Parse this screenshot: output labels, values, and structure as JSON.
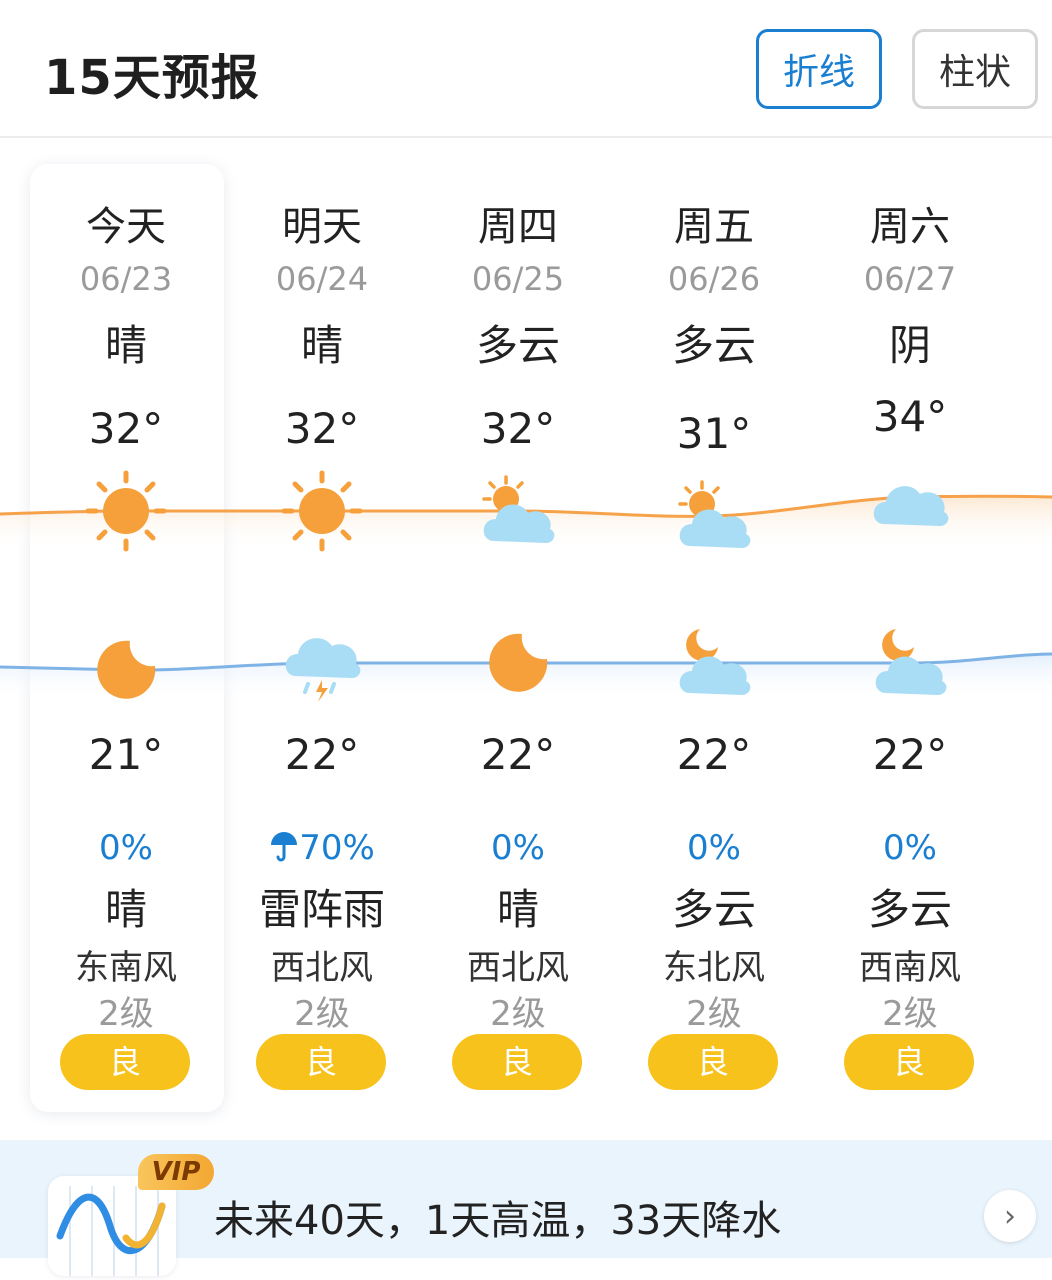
{
  "header": {
    "title": "15天预报",
    "toggle_line_label": "折线",
    "toggle_bar_label": "柱状",
    "active_toggle": "折线"
  },
  "colors": {
    "accent": "#1a7fd1",
    "high_curve": "#f5a24a",
    "low_curve": "#7fb3e6",
    "aqi_good": "#f7c21c"
  },
  "days": [
    {
      "name": "今天",
      "date": "06/23",
      "day_cond": "晴",
      "high": "32°",
      "day_icon": "sun-icon",
      "night_icon": "moon-icon",
      "low": "21°",
      "precip": "0%",
      "precip_icon": "",
      "night_cond": "晴",
      "wind_dir": "东南风",
      "wind_level": "2级",
      "aqi": "良"
    },
    {
      "name": "明天",
      "date": "06/24",
      "day_cond": "晴",
      "high": "32°",
      "day_icon": "sun-icon",
      "night_icon": "thunder-rain-icon",
      "low": "22°",
      "precip": "70%",
      "precip_icon": "umbrella-icon",
      "night_cond": "雷阵雨",
      "wind_dir": "西北风",
      "wind_level": "2级",
      "aqi": "良"
    },
    {
      "name": "周四",
      "date": "06/25",
      "day_cond": "多云",
      "high": "32°",
      "day_icon": "partly-cloudy-day-icon",
      "night_icon": "moon-icon",
      "low": "22°",
      "precip": "0%",
      "precip_icon": "",
      "night_cond": "晴",
      "wind_dir": "西北风",
      "wind_level": "2级",
      "aqi": "良"
    },
    {
      "name": "周五",
      "date": "06/26",
      "day_cond": "多云",
      "high": "31°",
      "day_icon": "partly-cloudy-day-icon",
      "night_icon": "partly-cloudy-night-icon",
      "low": "22°",
      "precip": "0%",
      "precip_icon": "",
      "night_cond": "多云",
      "wind_dir": "东北风",
      "wind_level": "2级",
      "aqi": "良"
    },
    {
      "name": "周六",
      "date": "06/27",
      "day_cond": "阴",
      "high": "34°",
      "day_icon": "cloud-icon",
      "night_icon": "partly-cloudy-night-icon",
      "low": "22°",
      "precip": "0%",
      "precip_icon": "",
      "night_cond": "多云",
      "wind_dir": "西南风",
      "wind_level": "2级",
      "aqi": "良"
    }
  ],
  "banner": {
    "vip_label": "VIP",
    "text": "未来40天，1天高温，33天降水",
    "icon": "trend-chart-icon",
    "arrow_icon": "chevron-right-icon"
  }
}
